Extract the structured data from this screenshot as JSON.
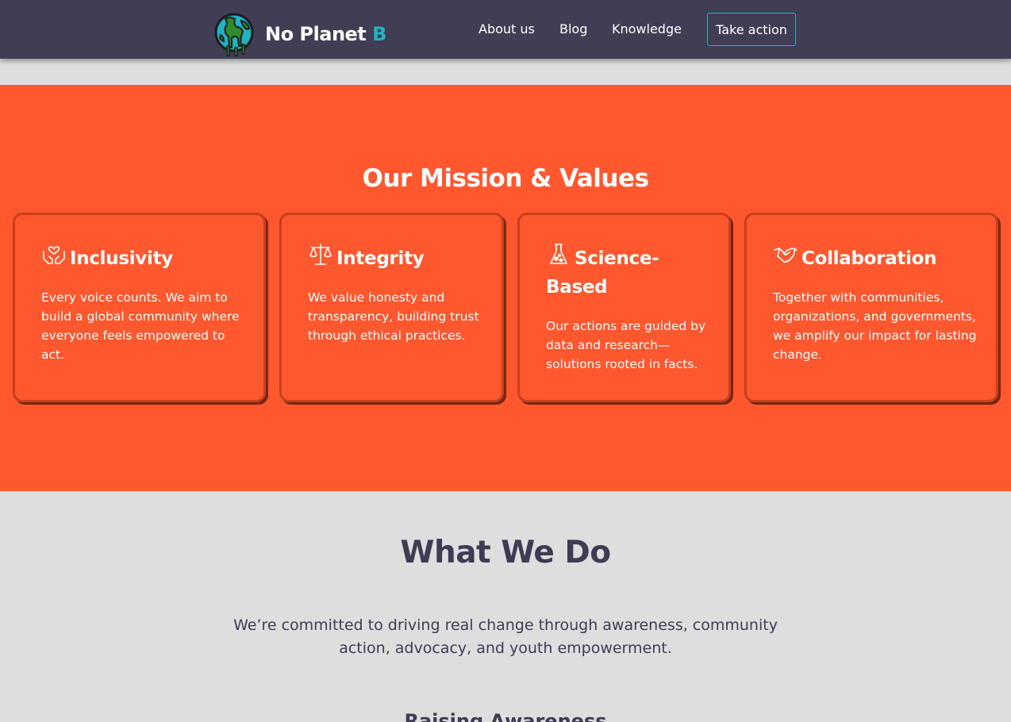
{
  "brand": {
    "name": "No Planet ",
    "accent": "B"
  },
  "nav": {
    "links": [
      "About us",
      "Blog",
      "Knowledge"
    ],
    "cta": "Take action"
  },
  "mission": {
    "title": "Our Mission & Values",
    "cards": [
      {
        "icon": "heart-hands-icon",
        "title": "Inclusivity",
        "text": "Every voice counts. We aim to build a global community where everyone feels empowered to act."
      },
      {
        "icon": "scales-icon",
        "title": "Integrity",
        "text": "We value honesty and transparency, building trust through ethical practices."
      },
      {
        "icon": "flask-icon",
        "title": "Science-Based",
        "text": "Our actions are guided by data and research—solutions rooted in facts."
      },
      {
        "icon": "handshake-icon",
        "title": "Collaboration",
        "text": "Together with communities, organizations, and governments, we amplify our impact for lasting change."
      }
    ]
  },
  "what_we_do": {
    "title": "What We Do",
    "text": "We’re committed to driving real change through awareness, community action, advocacy, and youth empowerment.",
    "first_item": "Raising Awareness"
  },
  "colors": {
    "header_bg": "#413d54",
    "accent_teal": "#1fb3c4",
    "mission_bg": "#ff572e",
    "page_bg": "#dedede",
    "heading_dark": "#3f3b53"
  }
}
